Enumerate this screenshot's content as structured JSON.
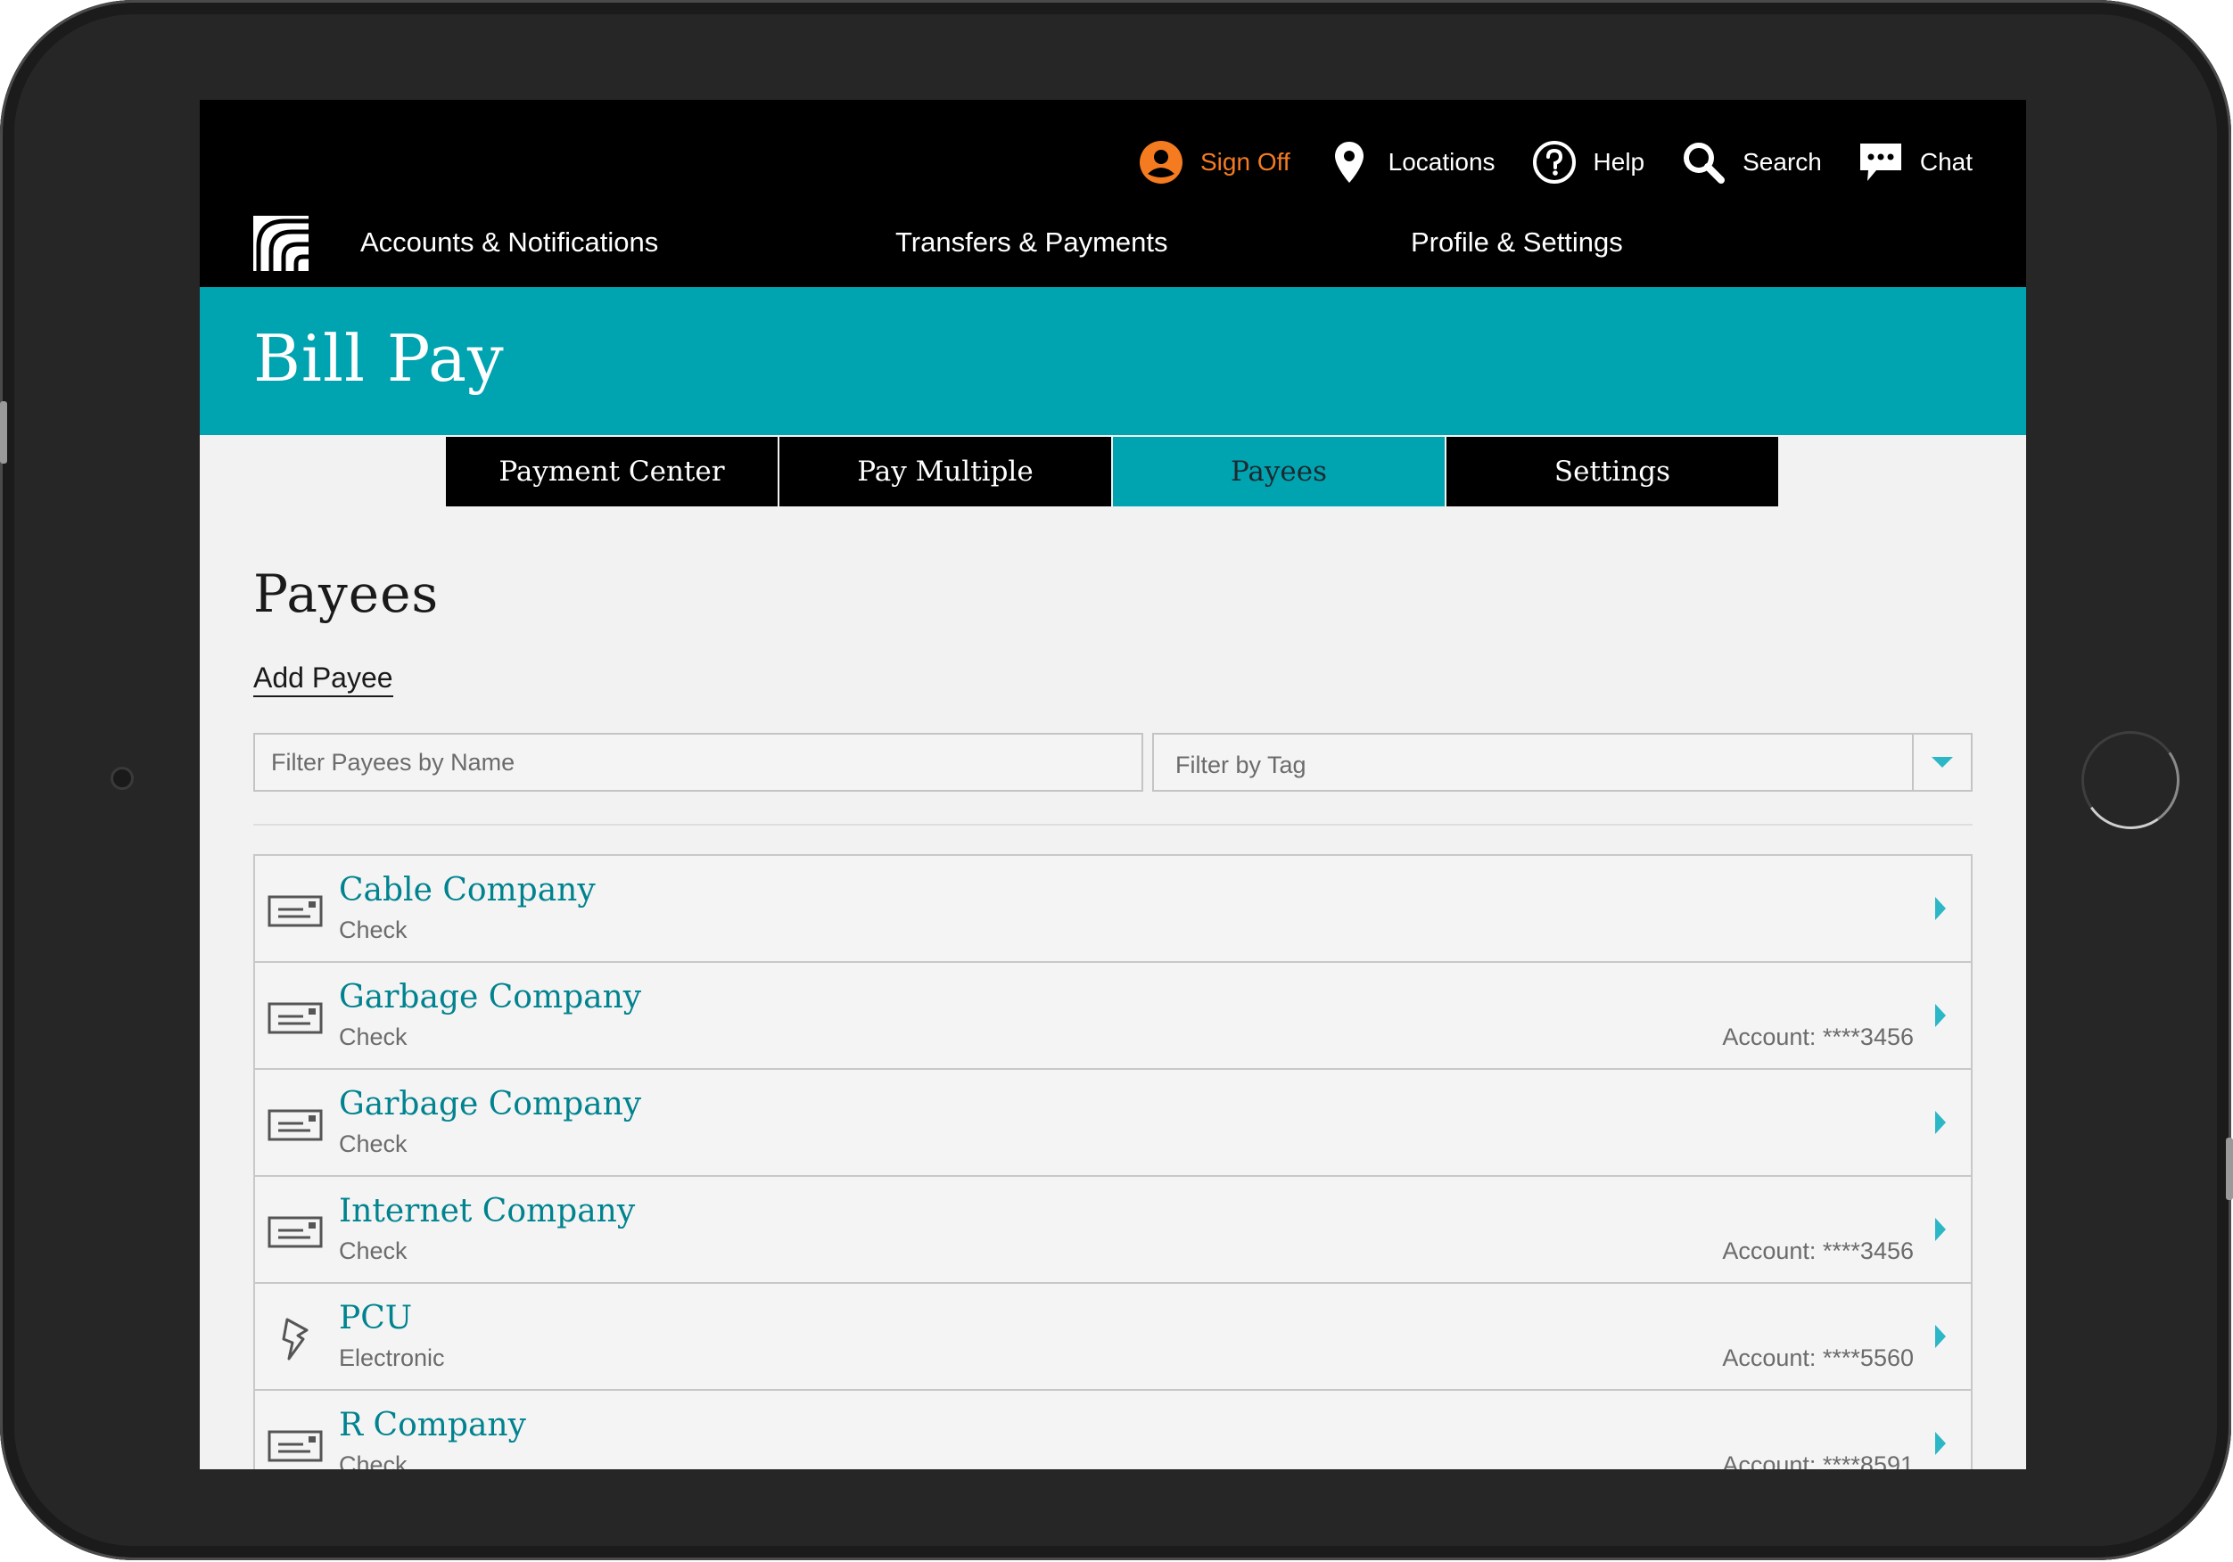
{
  "utility_nav": {
    "sign_off": "Sign Off",
    "locations": "Locations",
    "help": "Help",
    "search": "Search",
    "chat": "Chat"
  },
  "main_nav": {
    "accounts": "Accounts & Notifications",
    "transfers": "Transfers & Payments",
    "profile": "Profile & Settings"
  },
  "header": {
    "title": "Bill Pay"
  },
  "tabs": [
    {
      "label": "Payment Center",
      "active": false
    },
    {
      "label": "Pay Multiple",
      "active": false
    },
    {
      "label": "Payees",
      "active": true
    },
    {
      "label": "Settings",
      "active": false
    }
  ],
  "page": {
    "title": "Payees",
    "add_payee": "Add Payee"
  },
  "filters": {
    "name_placeholder": "Filter Payees by Name",
    "tag_placeholder": "Filter by Tag"
  },
  "payees": [
    {
      "name": "Cable Company",
      "type": "Check",
      "account": "",
      "icon": "check-envelope-icon"
    },
    {
      "name": "Garbage Company",
      "type": "Check",
      "account": "Account: ****3456",
      "icon": "check-envelope-icon"
    },
    {
      "name": "Garbage Company",
      "type": "Check",
      "account": "",
      "icon": "check-envelope-icon"
    },
    {
      "name": "Internet Company",
      "type": "Check",
      "account": "Account: ****3456",
      "icon": "check-envelope-icon"
    },
    {
      "name": "PCU",
      "type": "Electronic",
      "account": "Account: ****5560",
      "icon": "lightning-bolt-icon"
    },
    {
      "name": "R Company",
      "type": "Check",
      "account": "Account: ****8591",
      "icon": "check-envelope-icon"
    }
  ],
  "colors": {
    "accent": "#00a3b0",
    "link": "#00838f",
    "sign_off": "#f47b20",
    "chevron": "#2bb7c6"
  }
}
